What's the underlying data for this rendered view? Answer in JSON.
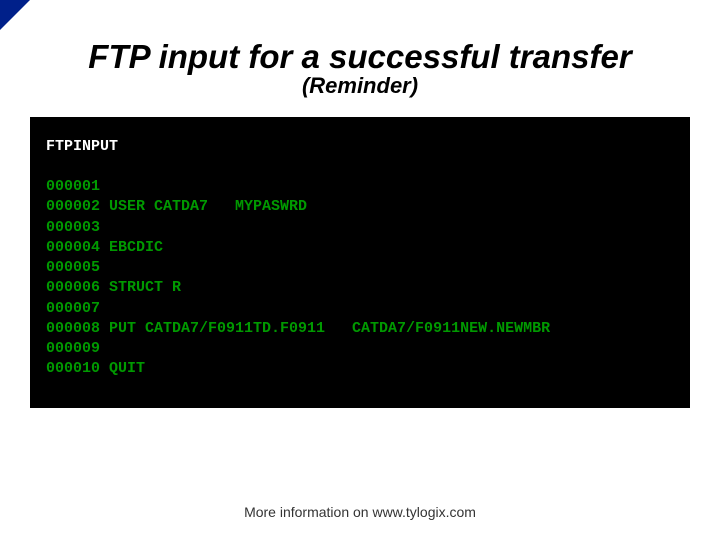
{
  "title": "FTP input for a successful transfer",
  "subtitle": "(Reminder)",
  "terminal": {
    "header": "FTPINPUT",
    "blank": "",
    "l1": "000001",
    "l2": "000002 USER CATDA7   MYPASWRD",
    "l3": "000003",
    "l4": "000004 EBCDIC",
    "l5": "000005",
    "l6": "000006 STRUCT R",
    "l7": "000007",
    "l8": "000008 PUT CATDA7/F0911TD.F0911   CATDA7/F0911NEW.NEWMBR",
    "l9": "000009",
    "l10": "000010 QUIT"
  },
  "footer": "More information on www.tylogix.com"
}
